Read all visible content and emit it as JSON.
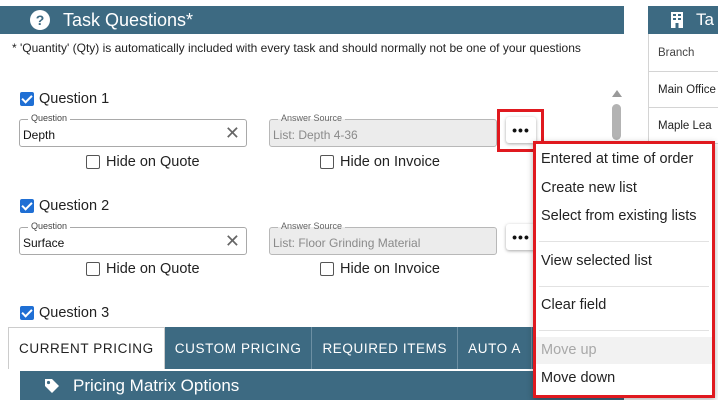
{
  "panel": {
    "title": "Task Questions*"
  },
  "note": "* 'Quantity' (Qty) is automatically included with every task and should normally not be one of your questions",
  "questions": [
    {
      "label": "Question 1",
      "question_legend": "Question",
      "question_value": "Depth",
      "source_legend": "Answer Source",
      "source_value": "List: Depth 4-36",
      "hide_quote": "Hide on Quote",
      "hide_invoice": "Hide on Invoice"
    },
    {
      "label": "Question 2",
      "question_legend": "Question",
      "question_value": "Surface",
      "source_legend": "Answer Source",
      "source_value": "List: Floor Grinding Material",
      "hide_quote": "Hide on Quote",
      "hide_invoice": "Hide on Invoice"
    },
    {
      "label": "Question 3"
    }
  ],
  "more_glyph": "•••",
  "clear_glyph": "✕",
  "tabs": [
    "CURRENT PRICING",
    "CUSTOM PRICING",
    "REQUIRED ITEMS",
    "AUTO A"
  ],
  "pricing": {
    "title": "Pricing Matrix Options"
  },
  "right_panel": {
    "title": "Ta",
    "header": "Branch",
    "rows": [
      "Main Office",
      "Maple Lea"
    ]
  },
  "menu": {
    "items": [
      "Entered at time of order",
      "Create new list",
      "Select from existing lists",
      "View selected list",
      "Clear field",
      "Move up",
      "Move down"
    ]
  },
  "colors": {
    "header_bg": "#3d6a82",
    "highlight": "#e0191f",
    "checkbox": "#1f6fd4"
  },
  "icons": [
    "help-icon",
    "building-icon",
    "tag-icon",
    "more-icon",
    "clear-icon"
  ]
}
